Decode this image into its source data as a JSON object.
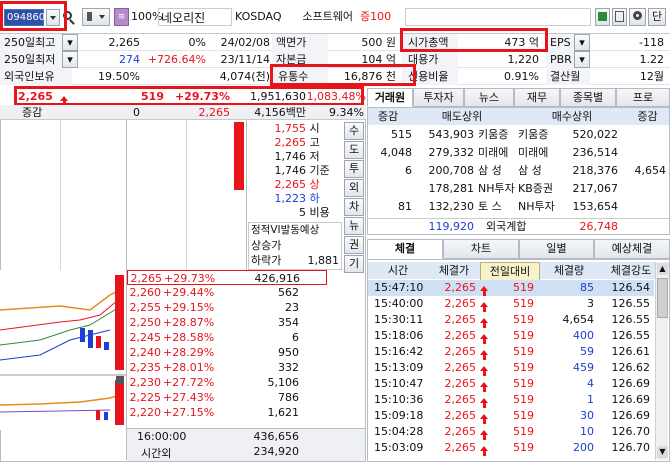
{
  "toolbar": {
    "code": "094860",
    "pct_btn": "100%",
    "name": "네오리진",
    "market": "KOSDAQ",
    "industry": "소프트웨어",
    "margin": "증100",
    "btn_single": "단",
    "icons": [
      "search-icon",
      "speaker-icon",
      "settings-icon",
      "window-icon"
    ]
  },
  "info": {
    "row1": {
      "l1": "250일최고",
      "v1": "2,265",
      "p1": "0%",
      "d1": "24/02/08",
      "l2": "액면가",
      "v2": "500 원",
      "l3": "시가총액",
      "v3": "473 억",
      "l4": "EPS",
      "v4": "-118"
    },
    "row2": {
      "l1": "250일최저",
      "v1": "274",
      "p1": "+726.64%",
      "d1": "23/11/14",
      "l2": "자본금",
      "v2": "104 억",
      "l3": "대용가",
      "v3": "1,220",
      "l4": "PBR",
      "v4": "1.22"
    },
    "row3": {
      "l1": "외국인보유",
      "v1": "19.50%",
      "p1": "4,074(천)",
      "l2": "유통수",
      "v2": "16,876 천",
      "l3": "신용비율",
      "v3": "0.91%",
      "l4": "결산월",
      "v4": "12월"
    }
  },
  "quote": {
    "price": "2,265",
    "change": "519",
    "rate": "+29.73%",
    "volume": "1,951,630",
    "vol_rate": "1,083.48%",
    "label_change": "증감",
    "zero": "0",
    "ask_total": "2,265",
    "amount": "4,156백만",
    "rate2": "9.34%"
  },
  "summary": [
    {
      "v": "1,755",
      "k": "시"
    },
    {
      "v": "2,265",
      "k": "고"
    },
    {
      "v": "1,746",
      "k": "저"
    },
    {
      "v": "1,746",
      "k": "기준"
    },
    {
      "v": "2,265",
      "k": "상"
    },
    {
      "v": "1,223",
      "k": "하"
    },
    {
      "v": "5",
      "k": "비용"
    }
  ],
  "vi": {
    "title": "정적VI발동예상",
    "up": "상승가",
    "down": "하락가",
    "down_v": "1,881"
  },
  "side_tabs": [
    "수",
    "도",
    "투",
    "외",
    "차",
    "뉴",
    "권",
    "기"
  ],
  "bids": [
    {
      "p": "2,265",
      "r": "+29.73%",
      "q": "426,916"
    },
    {
      "p": "2,260",
      "r": "+29.44%",
      "q": "562"
    },
    {
      "p": "2,255",
      "r": "+29.15%",
      "q": "23"
    },
    {
      "p": "2,250",
      "r": "+28.87%",
      "q": "354"
    },
    {
      "p": "2,245",
      "r": "+28.58%",
      "q": "6"
    },
    {
      "p": "2,240",
      "r": "+28.29%",
      "q": "950"
    },
    {
      "p": "2,235",
      "r": "+28.01%",
      "q": "332"
    },
    {
      "p": "2,230",
      "r": "+27.72%",
      "q": "5,106"
    },
    {
      "p": "2,225",
      "r": "+27.43%",
      "q": "786"
    },
    {
      "p": "2,220",
      "r": "+27.15%",
      "q": "1,621"
    }
  ],
  "bottom": {
    "time": "16:00:00",
    "t1": "436,656",
    "label": "시간외",
    "t2": "234,920"
  },
  "broker": {
    "tabs": [
      "거래원",
      "투자자",
      "뉴스",
      "재무",
      "종목별",
      "프로"
    ],
    "headers": {
      "change1": "증감",
      "sell": "매도상위",
      "buy": "매수상위",
      "change2": "증감"
    },
    "rows": [
      {
        "c1": "515",
        "sq": "543,903",
        "sn": "키움증",
        "bn": "키움증",
        "bq": "520,022",
        "c2": ""
      },
      {
        "c1": "4,048",
        "sq": "279,332",
        "sn": "미래에",
        "bn": "미래에",
        "bq": "236,514",
        "c2": ""
      },
      {
        "c1": "6",
        "sq": "200,708",
        "sn": "삼 성",
        "bn": "삼 성",
        "bq": "218,376",
        "c2": "4,654"
      },
      {
        "c1": "",
        "sq": "178,281",
        "sn": "NH투자",
        "bn": "KB증권",
        "bq": "217,067",
        "c2": ""
      },
      {
        "c1": "81",
        "sq": "132,230",
        "sn": "토 스",
        "bn": "NH투자",
        "bq": "153,654",
        "c2": ""
      }
    ],
    "foreign": {
      "sell": "119,920",
      "label": "외국계합",
      "buy": "26,748"
    }
  },
  "trades": {
    "tabs": [
      "체결",
      "차트",
      "일별",
      "예상체결"
    ],
    "headers": [
      "시간",
      "체결가",
      "전일대비",
      "체결량",
      "체결강도"
    ],
    "rows": [
      {
        "t": "15:47:10",
        "p": "2,265",
        "d": "519",
        "q": "85",
        "s": "126.54",
        "qc": "blue"
      },
      {
        "t": "15:40:00",
        "p": "2,265",
        "d": "519",
        "q": "3",
        "s": "126.55",
        "qc": "black"
      },
      {
        "t": "15:30:11",
        "p": "2,265",
        "d": "519",
        "q": "4,654",
        "s": "126.55",
        "qc": "black"
      },
      {
        "t": "15:18:06",
        "p": "2,265",
        "d": "519",
        "q": "400",
        "s": "126.55",
        "qc": "blue"
      },
      {
        "t": "15:16:42",
        "p": "2,265",
        "d": "519",
        "q": "59",
        "s": "126.61",
        "qc": "blue"
      },
      {
        "t": "15:13:09",
        "p": "2,265",
        "d": "519",
        "q": "459",
        "s": "126.62",
        "qc": "blue"
      },
      {
        "t": "15:10:47",
        "p": "2,265",
        "d": "519",
        "q": "4",
        "s": "126.69",
        "qc": "blue"
      },
      {
        "t": "15:10:36",
        "p": "2,265",
        "d": "519",
        "q": "1",
        "s": "126.69",
        "qc": "blue"
      },
      {
        "t": "15:09:18",
        "p": "2,265",
        "d": "519",
        "q": "30",
        "s": "126.69",
        "qc": "blue"
      },
      {
        "t": "15:04:28",
        "p": "2,265",
        "d": "519",
        "q": "10",
        "s": "126.70",
        "qc": "blue"
      },
      {
        "t": "15:03:09",
        "p": "2,265",
        "d": "519",
        "q": "200",
        "s": "126.70",
        "qc": "blue"
      }
    ]
  },
  "colors": {
    "up": "#e8141c",
    "down": "#1c3fd6",
    "header_bg": "#dfe8f5",
    "highlight": "#e8141c"
  }
}
